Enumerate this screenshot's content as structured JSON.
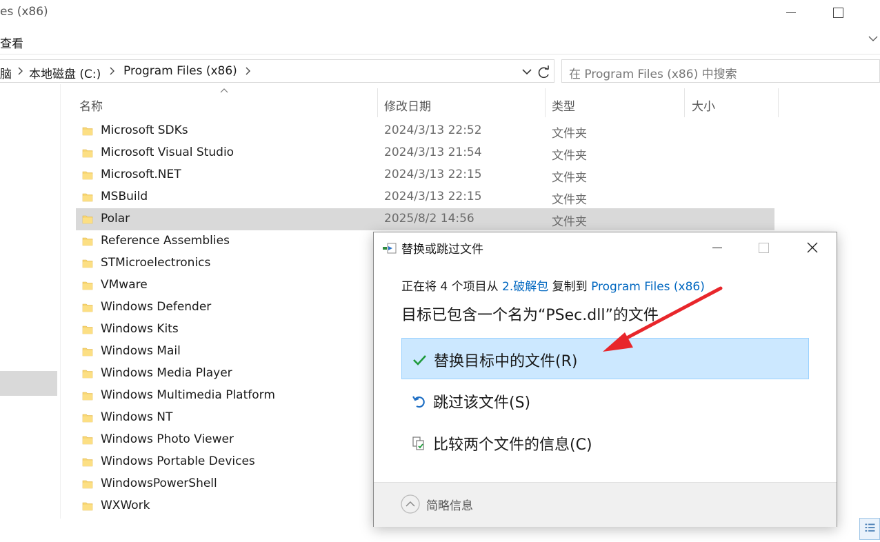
{
  "window": {
    "title": "es (x86)"
  },
  "ribbon": {
    "tab_view": "查看"
  },
  "address": {
    "crumbs": [
      "脑",
      "本地磁盘 (C:)",
      "Program Files (x86)"
    ]
  },
  "search": {
    "placeholder": "在 Program Files (x86) 中搜索"
  },
  "columns": {
    "name": "名称",
    "modified": "修改日期",
    "type": "类型",
    "size": "大小"
  },
  "files": [
    {
      "name": "Microsoft SDKs",
      "date": "2024/3/13 22:52",
      "type": "文件夹"
    },
    {
      "name": "Microsoft Visual Studio",
      "date": "2024/3/13 21:54",
      "type": "文件夹"
    },
    {
      "name": "Microsoft.NET",
      "date": "2024/3/13 22:15",
      "type": "文件夹"
    },
    {
      "name": "MSBuild",
      "date": "2024/3/13 22:15",
      "type": "文件夹"
    },
    {
      "name": "Polar",
      "date": "2025/8/2 14:56",
      "type": "文件夹"
    },
    {
      "name": "Reference Assemblies"
    },
    {
      "name": "STMicroelectronics"
    },
    {
      "name": "VMware"
    },
    {
      "name": "Windows Defender"
    },
    {
      "name": "Windows Kits"
    },
    {
      "name": "Windows Mail"
    },
    {
      "name": "Windows Media Player"
    },
    {
      "name": "Windows Multimedia Platform"
    },
    {
      "name": "Windows NT"
    },
    {
      "name": "Windows Photo Viewer"
    },
    {
      "name": "Windows Portable Devices"
    },
    {
      "name": "WindowsPowerShell"
    },
    {
      "name": "WXWork"
    }
  ],
  "dialog": {
    "title": "替换或跳过文件",
    "status_prefix": "正在将 4 个项目从 ",
    "source": "2.破解包",
    "status_middle": " 复制到 ",
    "destination": "Program Files (x86)",
    "heading": "目标已包含一个名为“PSec.dll”的文件",
    "options": {
      "replace": "替换目标中的文件(R)",
      "skip": "跳过该文件(S)",
      "compare": "比较两个文件的信息(C)"
    },
    "footer": {
      "details": "简略信息"
    }
  },
  "colors": {
    "accent": "#0067c0",
    "selection": "#cce8ff",
    "selection_border": "#99d1ff",
    "annotation_arrow": "#e8262b"
  }
}
